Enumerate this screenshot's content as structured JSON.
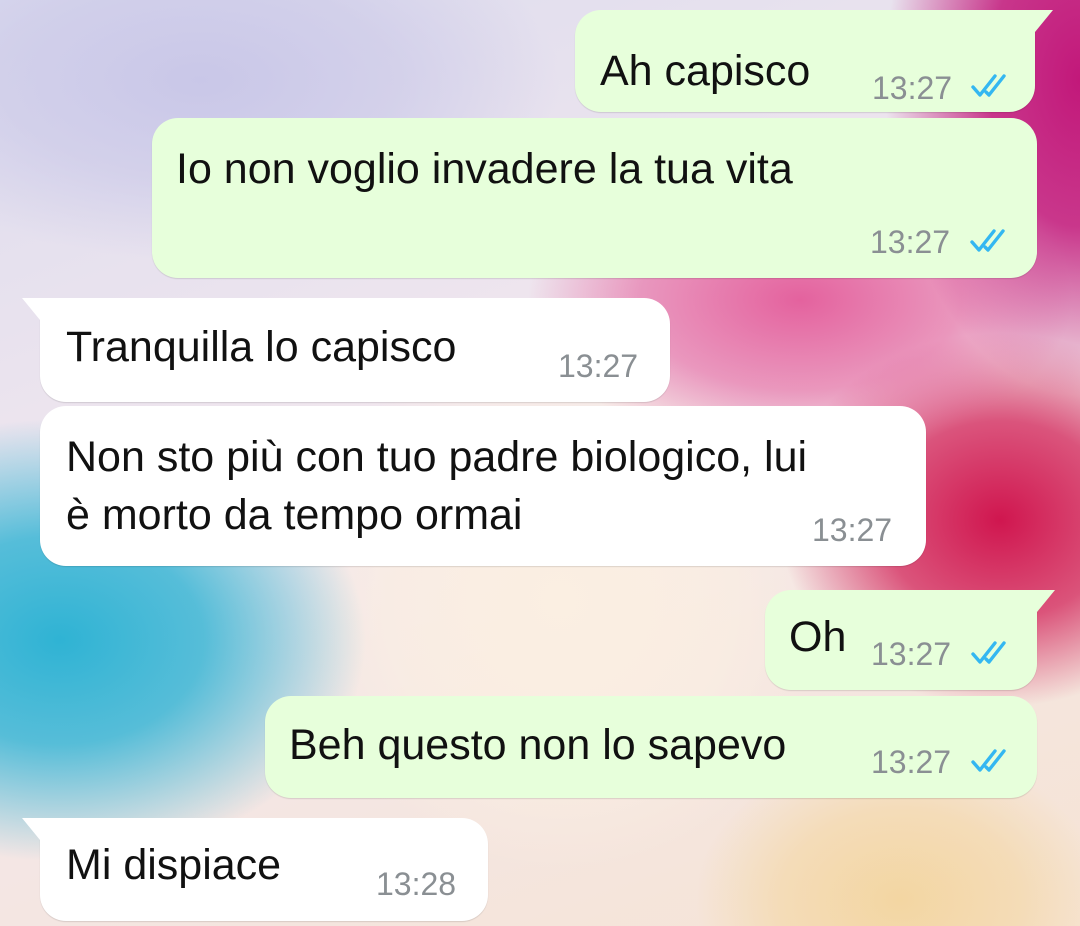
{
  "colors": {
    "outgoing_bubble": "#e7ffdb",
    "incoming_bubble": "#ffffff",
    "read_ticks": "#34b7f1",
    "timestamp": "#8a8f93"
  },
  "messages": [
    {
      "direction": "outgoing",
      "text": "Ah capisco",
      "time": "13:27",
      "status": "read-ticks-icon"
    },
    {
      "direction": "outgoing",
      "text": "Io non voglio invadere la tua vita",
      "time": "13:27",
      "status": "read-ticks-icon"
    },
    {
      "direction": "incoming",
      "text": "Tranquilla lo capisco",
      "time": "13:27"
    },
    {
      "direction": "incoming",
      "lines": [
        "Non sto più con tuo padre biologico, lui",
        "è morto da tempo ormai"
      ],
      "time": "13:27"
    },
    {
      "direction": "outgoing",
      "text": "Oh",
      "time": "13:27",
      "status": "read-ticks-icon"
    },
    {
      "direction": "outgoing",
      "text": "Beh questo non lo sapevo",
      "time": "13:27",
      "status": "read-ticks-icon"
    },
    {
      "direction": "incoming",
      "text": "Mi dispiace",
      "time": "13:28"
    }
  ]
}
